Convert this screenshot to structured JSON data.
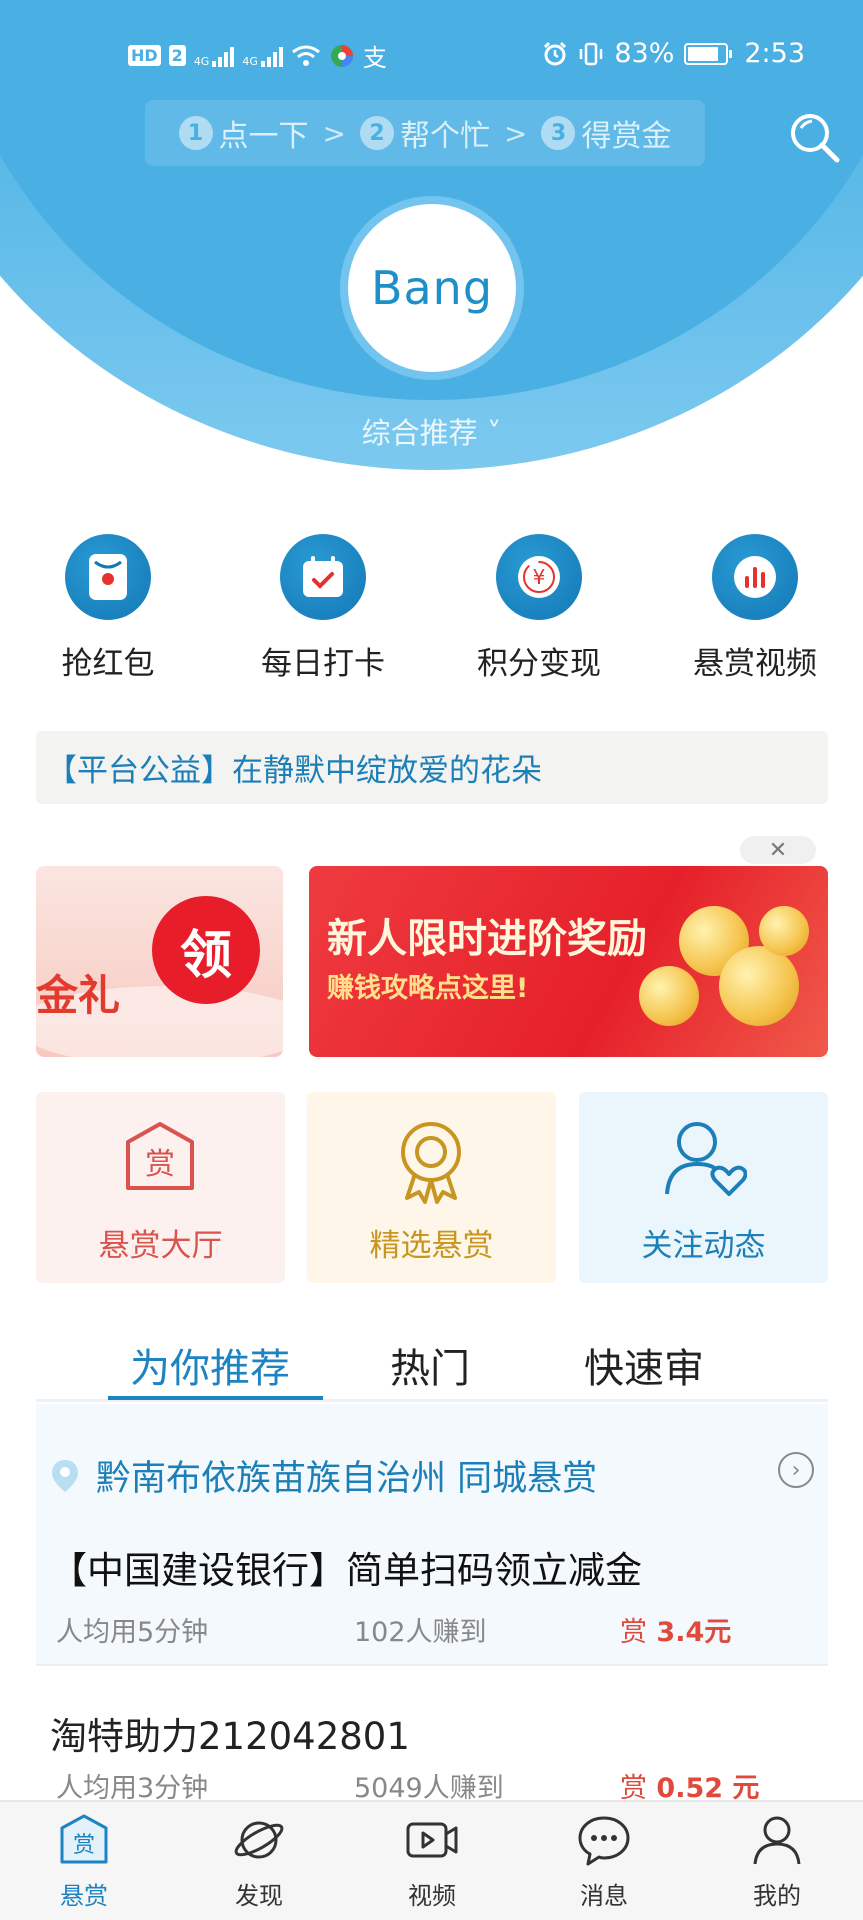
{
  "status_bar": {
    "hd_label": "HD",
    "sim_label": "2",
    "net1": "4G",
    "net2": "4G",
    "pay_icon": "支",
    "battery_percent": "83%",
    "time": "2:53"
  },
  "steps": [
    {
      "num": "1",
      "label": "点一下"
    },
    {
      "num": "2",
      "label": "帮个忙"
    },
    {
      "num": "3",
      "label": "得赏金"
    }
  ],
  "step_arrow": ">",
  "logo_text": "Bang",
  "category_selector": "综合推荐 ˅",
  "quick_actions": [
    {
      "label": "抢红包",
      "icon": "red-packet-icon"
    },
    {
      "label": "每日打卡",
      "icon": "calendar-check-icon"
    },
    {
      "label": "积分变现",
      "icon": "yuan-exchange-icon"
    },
    {
      "label": "悬赏视频",
      "icon": "bar-chart-icon"
    }
  ],
  "notice": "【平台公益】在静默中绽放爱的花朵",
  "banners": {
    "close": "✕",
    "left_text": "金礼",
    "left_badge": "领",
    "right_title": "新人限时进阶奖励",
    "right_subtitle": "赚钱攻略点这里!"
  },
  "entries": [
    {
      "label": "悬赏大厅",
      "icon": "reward-hall-icon",
      "bg": "#fdf1ef",
      "color": "#d9534f"
    },
    {
      "label": "精选悬赏",
      "icon": "medal-icon",
      "bg": "#fef6e9",
      "color": "#c89620"
    },
    {
      "label": "关注动态",
      "icon": "user-heart-icon",
      "bg": "#eaf6fc",
      "color": "#1d7fb8"
    }
  ],
  "tabs": [
    "为你推荐",
    "热门",
    "快速审"
  ],
  "feed": {
    "city": "黔南布依族苗族自治州 同城悬赏",
    "tasks": [
      {
        "title": "【中国建设银行】简单扫码领立减金",
        "time": "人均用5分钟",
        "earned": "102人赚到",
        "reward_mark": "赏",
        "reward": "3.4元"
      },
      {
        "title": "淘特助力212042801",
        "time": "人均用3分钟",
        "earned": "5049人赚到",
        "reward_mark": "赏",
        "reward": "0.52 元"
      }
    ]
  },
  "bottom_nav": [
    {
      "label": "悬赏",
      "icon": "reward-tab-icon",
      "badge_char": "赏"
    },
    {
      "label": "发现",
      "icon": "planet-icon"
    },
    {
      "label": "视频",
      "icon": "video-icon"
    },
    {
      "label": "消息",
      "icon": "chat-icon"
    },
    {
      "label": "我的",
      "icon": "profile-icon"
    }
  ],
  "colors": {
    "brand_blue": "#4ab0e4",
    "accent_blue": "#1d83c3",
    "reward_red": "#e04a3c"
  }
}
